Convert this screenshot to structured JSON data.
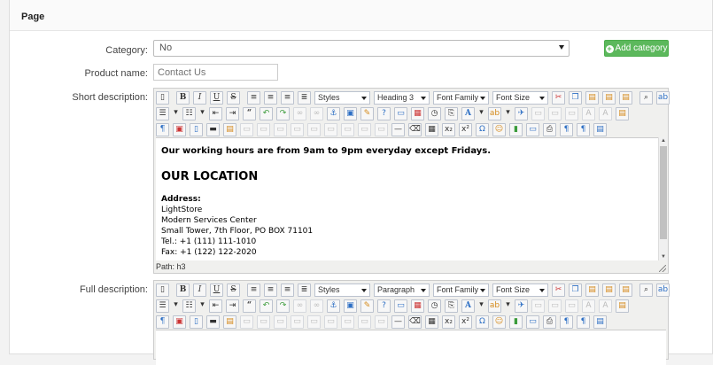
{
  "panel": {
    "title": "Page"
  },
  "form": {
    "category_label": "Category:",
    "category_value": "No",
    "add_category": "Add category",
    "product_name_label": "Product name:",
    "product_name_placeholder": "Contact Us",
    "short_desc_label": "Short description:",
    "full_desc_label": "Full description:"
  },
  "editor_short": {
    "styles": "Styles",
    "format": "Heading 3",
    "font_family": "Font Family",
    "font_size": "Font Size",
    "path": "Path: h3",
    "content": {
      "hours": "Our working hours are from 9am to 9pm everyday except Fridays.",
      "location_heading": "OUR LOCATION",
      "address_label": "Address:",
      "lines": [
        "LightStore",
        "Modern Services Center",
        "Small Tower, 7th Floor, PO BOX 71101",
        "Tel.: +1 (111) 111-1010",
        "Fax: +1 (122) 122-2020"
      ]
    }
  },
  "editor_full": {
    "styles": "Styles",
    "format": "Paragraph",
    "font_family": "Font Family",
    "font_size": "Font Size"
  },
  "colors": {
    "add_button": "#5cb85c",
    "icon_blue": "#2d6fc4"
  }
}
